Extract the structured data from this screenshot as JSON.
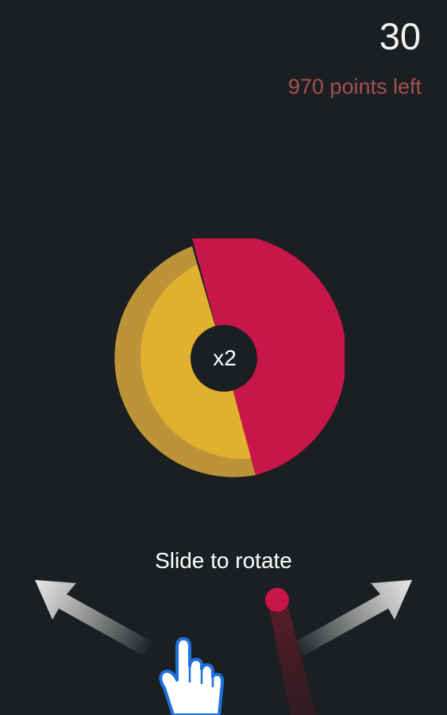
{
  "score": "30",
  "points_left": "970 points left",
  "wheel": {
    "multiplier": "x2",
    "colors": {
      "yellow": "#e1b02f",
      "yellow_rim": "#bd9338",
      "red": "#c8154a",
      "center": "#1b1f21"
    }
  },
  "instruction": "Slide to rotate",
  "icons": {
    "left_arrow": "arrow-up-left-icon",
    "right_arrow": "arrow-up-right-icon",
    "hand": "pointing-hand-icon"
  },
  "colors": {
    "background": "#1b1f21",
    "score_text": "#f2f2f2",
    "points_left_text": "#a35150",
    "ball": "#c8154a"
  }
}
